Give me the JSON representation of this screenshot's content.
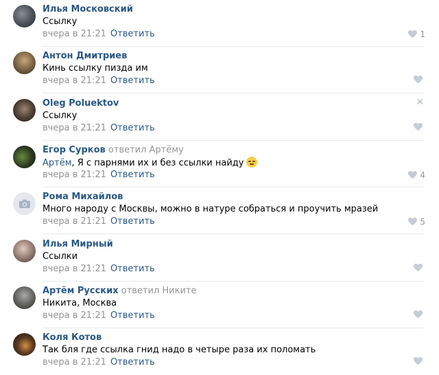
{
  "comments": [
    {
      "author": "Илья Московский",
      "replied_to": "",
      "mention": "",
      "text": "Ссылку",
      "time": "вчера в 21:21",
      "reply_label": "Ответить",
      "likes": "1"
    },
    {
      "author": "Антон Дмитриев",
      "replied_to": "",
      "mention": "",
      "text": "Кинь ссылку пизда им",
      "time": "вчера в 21:21",
      "reply_label": "Ответить",
      "likes": ""
    },
    {
      "author": "Oleg Poluektov",
      "replied_to": "",
      "mention": "",
      "text": "Ссылку",
      "time": "вчера в 21:21",
      "reply_label": "Ответить",
      "likes": ""
    },
    {
      "author": "Егор Сурков",
      "replied_to": "ответил Артёму",
      "mention": "Артём",
      "text": ", Я с парнями их и без ссылки найду",
      "time": "вчера в 21:21",
      "reply_label": "Ответить",
      "likes": "4"
    },
    {
      "author": "Рома Михайлов",
      "replied_to": "",
      "mention": "",
      "text": "Много народу с Москвы, можно в натуре собраться и проучить мразей",
      "time": "вчера в 21:21",
      "reply_label": "Ответить",
      "likes": "5"
    },
    {
      "author": "Илья Мирный",
      "replied_to": "",
      "mention": "",
      "text": "Ссылки",
      "time": "вчера в 21:21",
      "reply_label": "Ответить",
      "likes": ""
    },
    {
      "author": "Артём Русских",
      "replied_to": "ответил Никите",
      "mention": "",
      "text": "Никита, Москва",
      "time": "вчера в 21:21",
      "reply_label": "Ответить",
      "likes": ""
    },
    {
      "author": "Коля Котов",
      "replied_to": "",
      "mention": "",
      "text": "Так бля где ссылка гнид надо в четыре раза их поломать",
      "time": "вчера в 21:21",
      "reply_label": "Ответить",
      "likes": ""
    }
  ],
  "colors": {
    "link": "#2a5885",
    "muted": "#939393",
    "divider": "#e7e8ec",
    "like_icon": "#c5ccd6"
  },
  "icons": {
    "like": "heart-icon",
    "close": "close-icon",
    "no_avatar": "camera-icon",
    "emoji": "smiling-face-icon"
  }
}
